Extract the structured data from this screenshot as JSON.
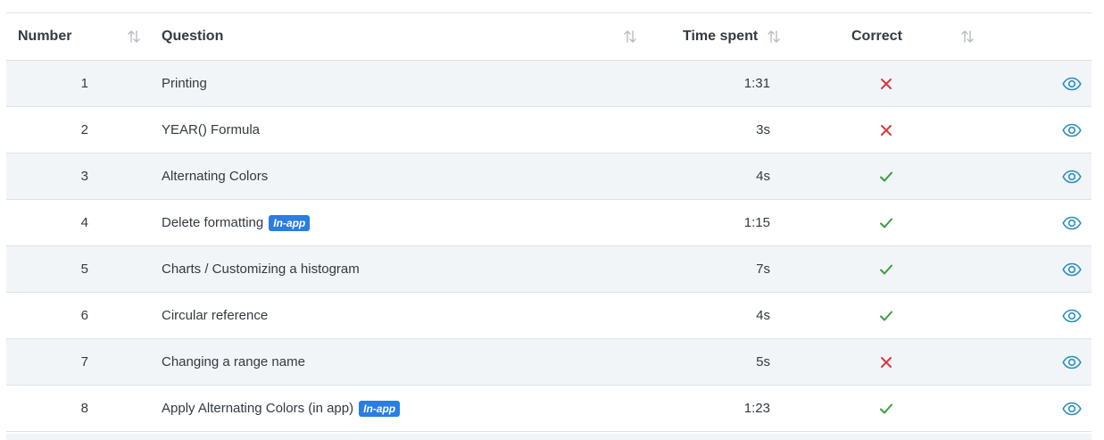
{
  "table": {
    "columns": {
      "number": "Number",
      "question": "Question",
      "time_spent": "Time spent",
      "correct": "Correct"
    },
    "rows": [
      {
        "number": "1",
        "question": "Printing",
        "badge": "",
        "time": "1:31",
        "correct": false
      },
      {
        "number": "2",
        "question": "YEAR() Formula",
        "badge": "",
        "time": "3s",
        "correct": false
      },
      {
        "number": "3",
        "question": "Alternating Colors",
        "badge": "",
        "time": "4s",
        "correct": true
      },
      {
        "number": "4",
        "question": "Delete formatting",
        "badge": "In-app",
        "time": "1:15",
        "correct": true
      },
      {
        "number": "5",
        "question": "Charts / Customizing a histogram",
        "badge": "",
        "time": "7s",
        "correct": true
      },
      {
        "number": "6",
        "question": "Circular reference",
        "badge": "",
        "time": "4s",
        "correct": true
      },
      {
        "number": "7",
        "question": "Changing a range name",
        "badge": "",
        "time": "5s",
        "correct": false
      },
      {
        "number": "8",
        "question": "Apply Alternating Colors (in app)",
        "badge": "In-app",
        "time": "1:23",
        "correct": true
      }
    ]
  },
  "colors": {
    "correct": "#3a9d3f",
    "incorrect": "#d9393c",
    "view_icon": "#2a8fc0",
    "badge": "#2a7de1",
    "sort_icon": "#b5bcc3"
  },
  "icons": {
    "sort": "sort-arrows-icon",
    "view": "eye-icon",
    "correct": "check-icon",
    "incorrect": "cross-icon"
  }
}
